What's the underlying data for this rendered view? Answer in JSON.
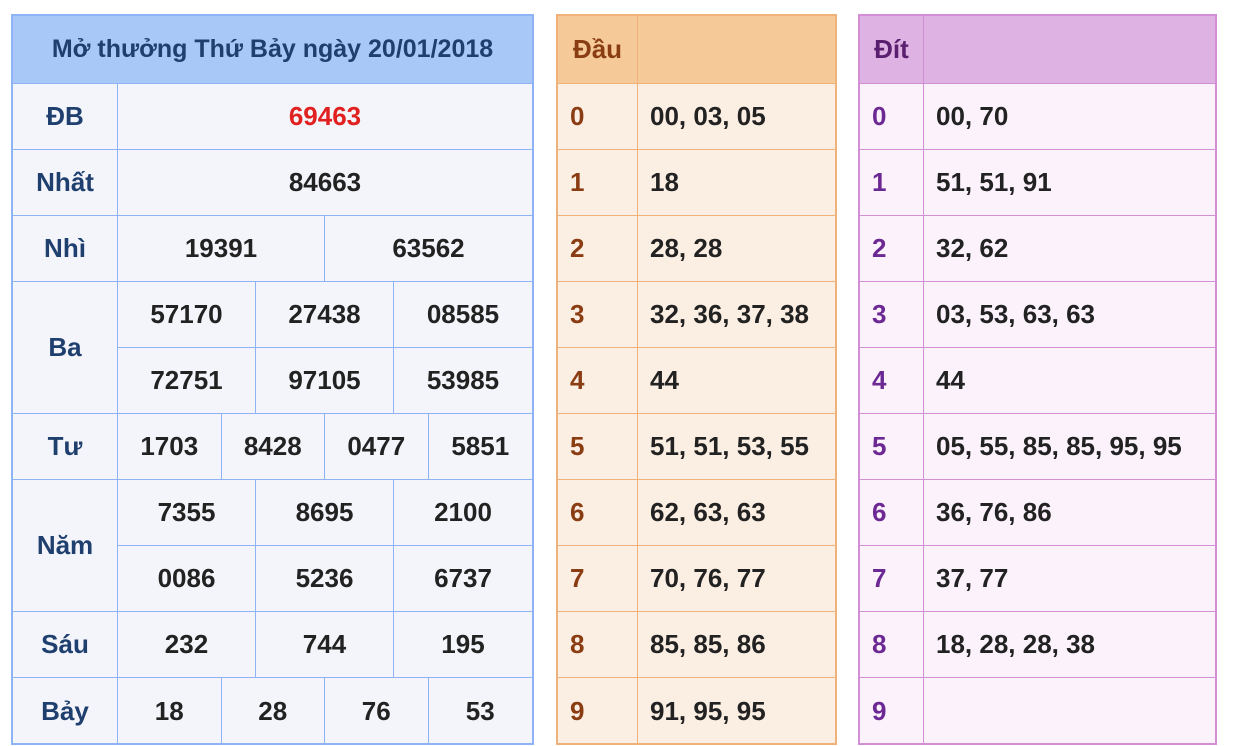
{
  "results": {
    "title": "Mở thưởng Thứ Bảy ngày 20/01/2018",
    "special_color": "#e12020",
    "db": {
      "label": "ĐB",
      "value": "69463"
    },
    "nhat": {
      "label": "Nhất",
      "values": [
        "84663"
      ]
    },
    "nhi": {
      "label": "Nhì",
      "values": [
        "19391",
        "63562"
      ]
    },
    "ba": {
      "label": "Ba",
      "values": [
        "57170",
        "27438",
        "08585",
        "72751",
        "97105",
        "53985"
      ]
    },
    "tu": {
      "label": "Tư",
      "values": [
        "1703",
        "8428",
        "0477",
        "5851"
      ]
    },
    "nam": {
      "label": "Năm",
      "values": [
        "7355",
        "8695",
        "2100",
        "0086",
        "5236",
        "6737"
      ]
    },
    "sau": {
      "label": "Sáu",
      "values": [
        "232",
        "744",
        "195"
      ]
    },
    "bay": {
      "label": "Bảy",
      "values": [
        "18",
        "28",
        "76",
        "53"
      ]
    }
  },
  "dau": {
    "title": "Đầu",
    "rows": [
      {
        "digit": "0",
        "values": "00, 03, 05"
      },
      {
        "digit": "1",
        "values": "18"
      },
      {
        "digit": "2",
        "values": "28, 28"
      },
      {
        "digit": "3",
        "values": "32, 36, 37, 38"
      },
      {
        "digit": "4",
        "values": "44"
      },
      {
        "digit": "5",
        "values": "51, 51, 53, 55"
      },
      {
        "digit": "6",
        "values": "62, 63, 63"
      },
      {
        "digit": "7",
        "values": "70, 76, 77"
      },
      {
        "digit": "8",
        "values": "85, 85, 86"
      },
      {
        "digit": "9",
        "values": "91, 95, 95"
      }
    ]
  },
  "dit": {
    "title": "Đít",
    "rows": [
      {
        "digit": "0",
        "values": "00, 70"
      },
      {
        "digit": "1",
        "values": "51, 51, 91"
      },
      {
        "digit": "2",
        "values": "32, 62"
      },
      {
        "digit": "3",
        "values": "03, 53, 63, 63"
      },
      {
        "digit": "4",
        "values": "44"
      },
      {
        "digit": "5",
        "values": "05, 55, 85, 85, 95, 95"
      },
      {
        "digit": "6",
        "values": "36, 76, 86"
      },
      {
        "digit": "7",
        "values": "37, 77"
      },
      {
        "digit": "8",
        "values": "18, 28, 28, 38"
      },
      {
        "digit": "9",
        "values": ""
      }
    ]
  }
}
